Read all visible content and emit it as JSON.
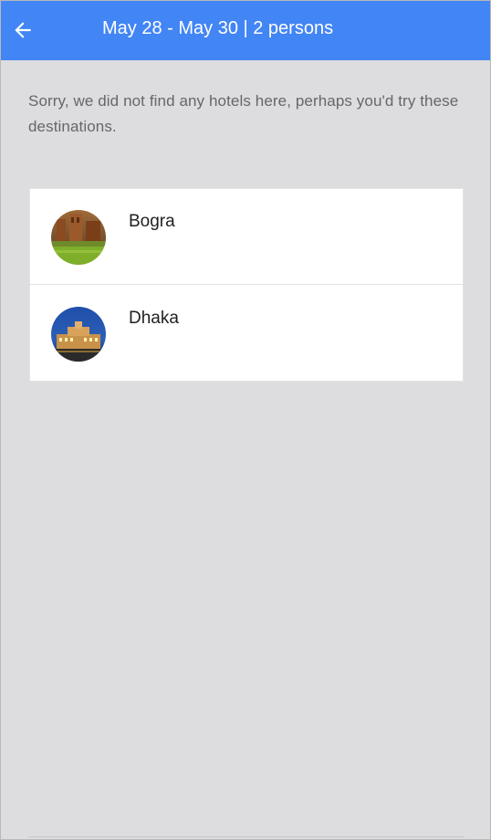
{
  "header": {
    "title": "May 28 - May 30 | 2 persons",
    "back_icon": "arrow-left-icon",
    "bg_color": "#4285f4"
  },
  "message": "Sorry, we did not find any hotels here, perhaps you'd try these destinations.",
  "destinations": [
    {
      "name": "Bogra",
      "icon": "destination-photo"
    },
    {
      "name": "Dhaka",
      "icon": "destination-photo"
    }
  ]
}
